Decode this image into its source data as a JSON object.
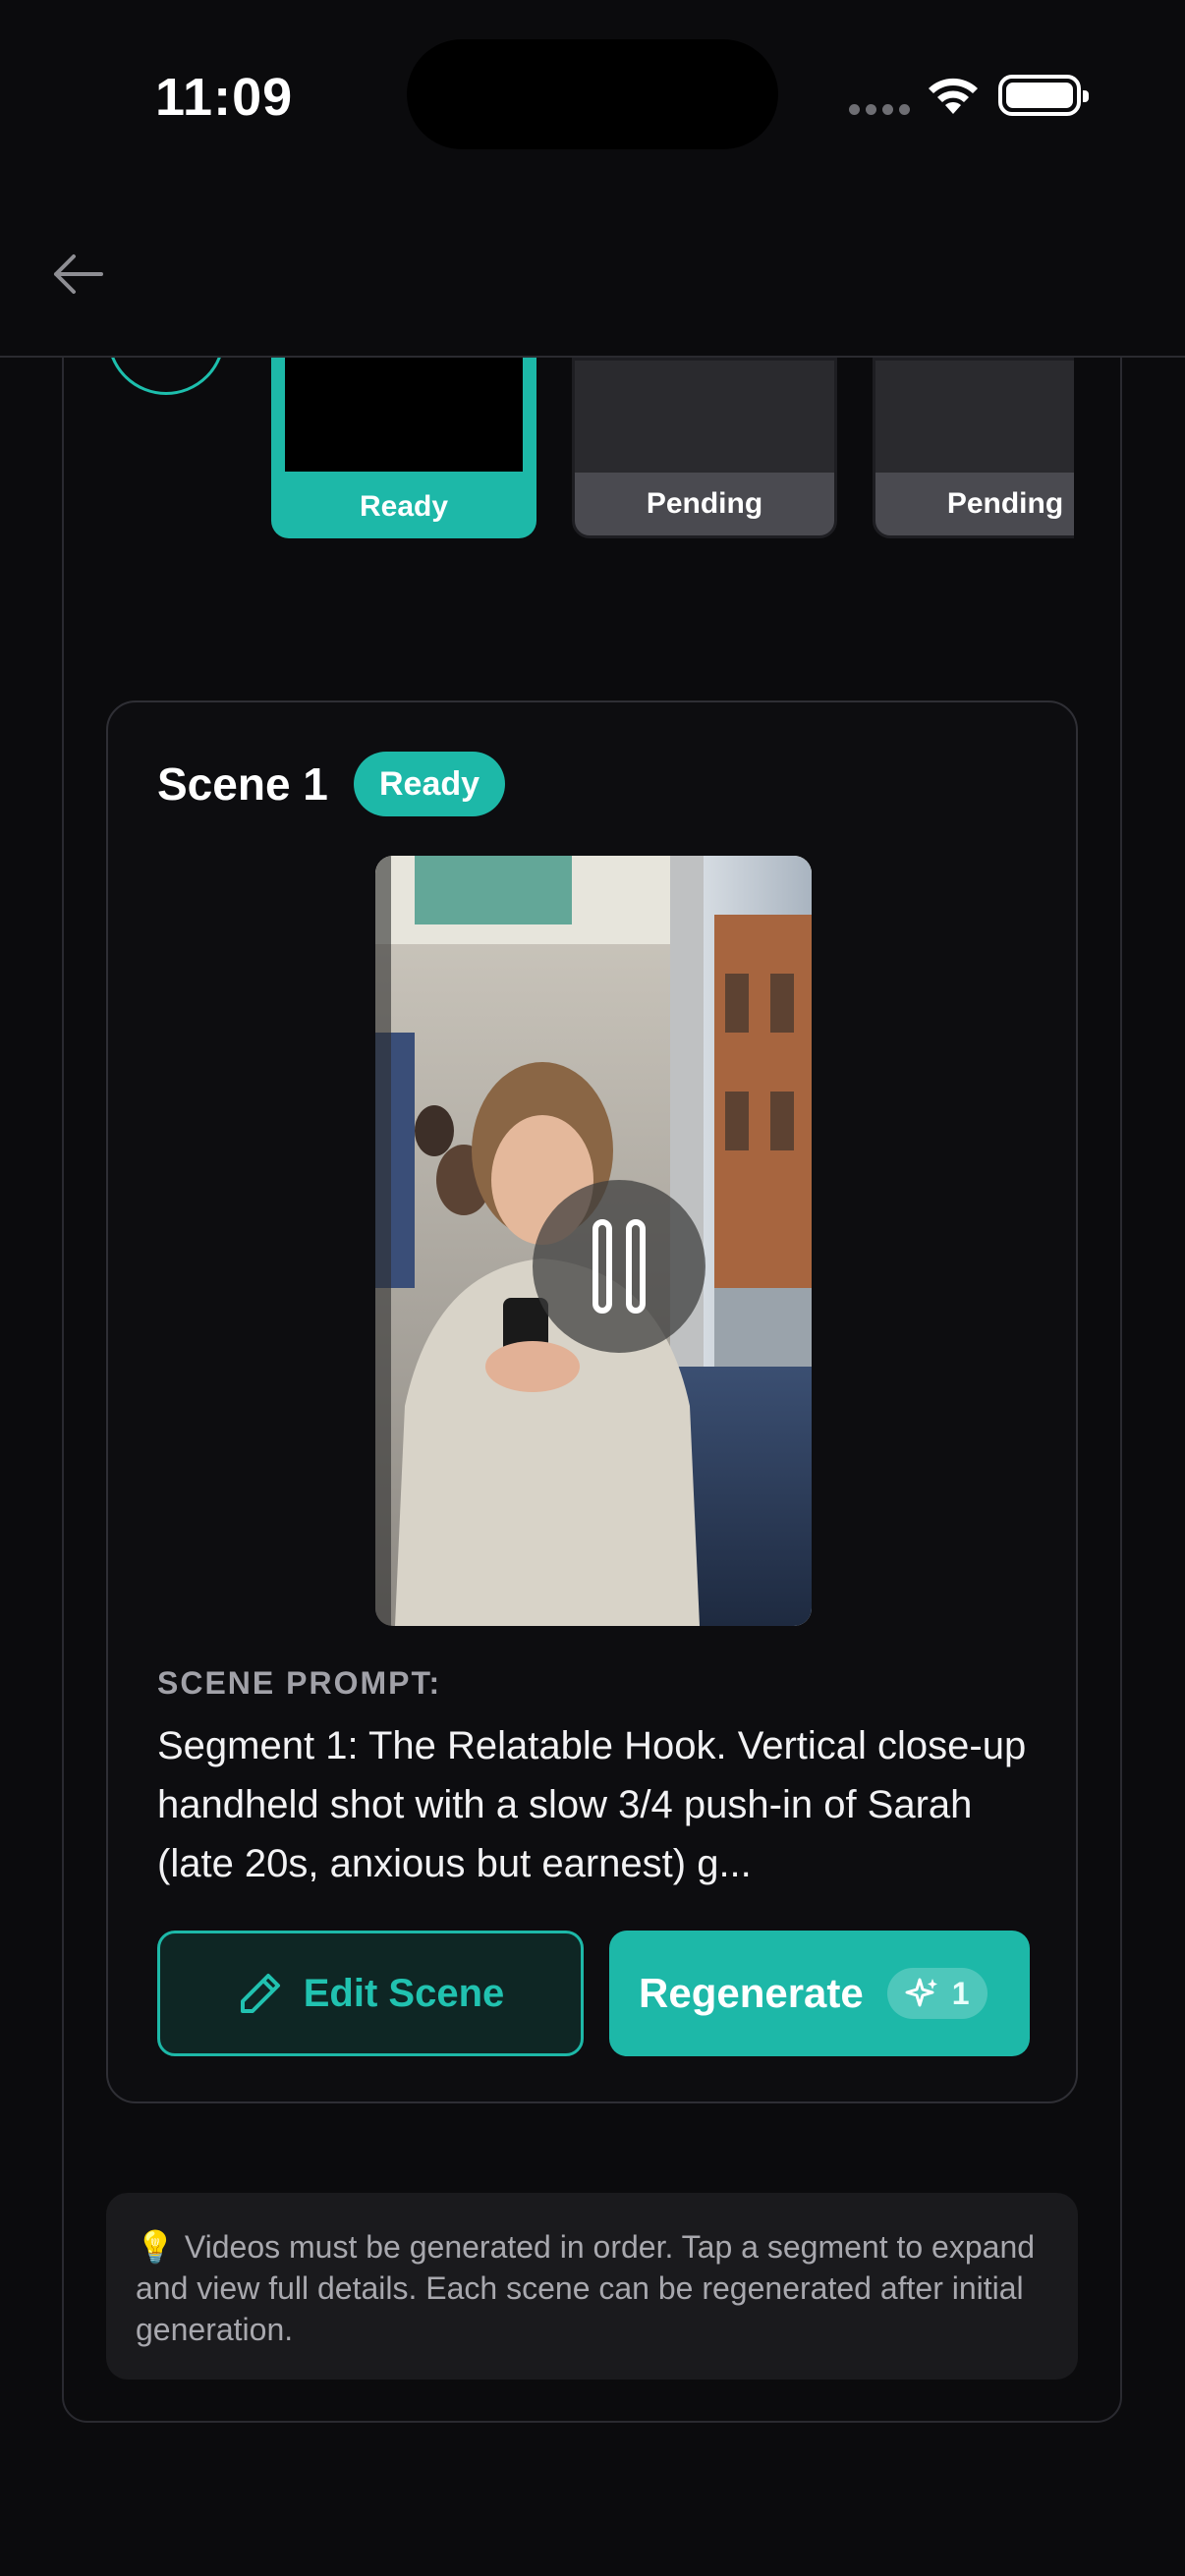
{
  "status": {
    "time": "11:09"
  },
  "segments": [
    {
      "label": "Ready",
      "state": "ready"
    },
    {
      "label": "Pending",
      "state": "pending"
    },
    {
      "label": "Pending",
      "state": "pending"
    }
  ],
  "scene": {
    "title": "Scene 1",
    "badge": "Ready",
    "prompt_label": "SCENE PROMPT:",
    "prompt_text": "Segment 1: The Relatable Hook. Vertical close-up handheld shot with a slow 3/4 push-in of Sarah (late 20s, anxious but earnest) g...",
    "edit_label": "Edit Scene",
    "regenerate_label": "Regenerate",
    "credits": "1"
  },
  "info": {
    "text": "Videos must be generated in order. Tap a segment to expand and view full details. Each scene can be regenerated after initial generation."
  },
  "colors": {
    "accent": "#1db8a8",
    "background": "#0b0b0d"
  }
}
